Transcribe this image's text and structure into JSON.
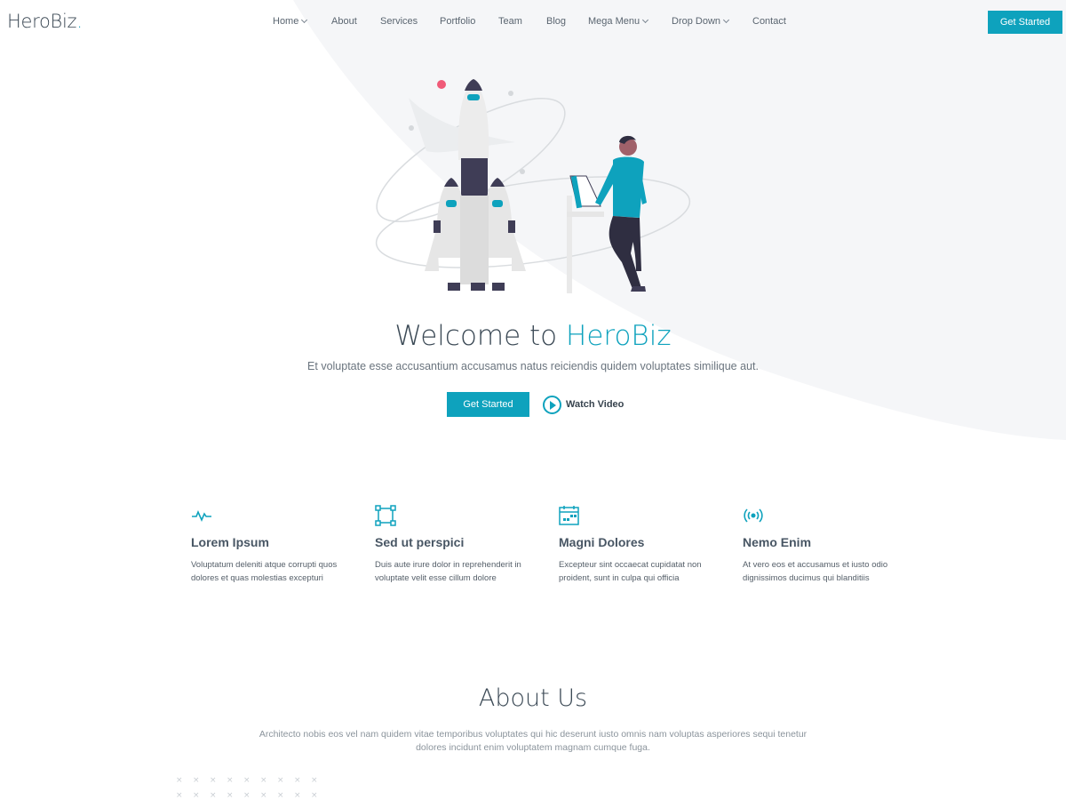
{
  "header": {
    "logo_text": "HeroBiz",
    "logo_dot": ".",
    "nav": [
      {
        "label": "Home",
        "dropdown": true
      },
      {
        "label": "About",
        "dropdown": false
      },
      {
        "label": "Services",
        "dropdown": false
      },
      {
        "label": "Portfolio",
        "dropdown": false
      },
      {
        "label": "Team",
        "dropdown": false
      },
      {
        "label": "Blog",
        "dropdown": false
      },
      {
        "label": "Mega Menu",
        "dropdown": true
      },
      {
        "label": "Drop Down",
        "dropdown": true
      },
      {
        "label": "Contact",
        "dropdown": false
      }
    ],
    "cta_label": "Get Started"
  },
  "hero": {
    "title_prefix": "Welcome to ",
    "title_accent": "HeroBiz",
    "subtitle": "Et voluptate esse accusantium accusamus natus reiciendis quidem voluptates similique aut.",
    "cta_label": "Get Started",
    "video_label": "Watch Video"
  },
  "features": [
    {
      "icon": "activity-icon",
      "title": "Lorem Ipsum",
      "description": "Voluptatum deleniti atque corrupti quos dolores et quas molestias excepturi"
    },
    {
      "icon": "bounding-box-icon",
      "title": "Sed ut perspici",
      "description": "Duis aute irure dolor in reprehenderit in voluptate velit esse cillum dolore"
    },
    {
      "icon": "calendar-icon",
      "title": "Magni Dolores",
      "description": "Excepteur sint occaecat cupidatat non proident, sunt in culpa qui officia"
    },
    {
      "icon": "broadcast-icon",
      "title": "Nemo Enim",
      "description": "At vero eos et accusamus et iusto odio dignissimos ducimus qui blanditiis"
    }
  ],
  "about": {
    "title": "About Us",
    "text": "Architecto nobis eos vel nam quidem vitae temporibus voluptates qui hic deserunt iusto omnis nam voluptas asperiores sequi tenetur dolores incidunt enim voluptatem magnam cumque fuga."
  },
  "colors": {
    "accent": "#0ea2bd",
    "heading": "#3c4a56",
    "hero_bg": "#f4f5f7"
  }
}
